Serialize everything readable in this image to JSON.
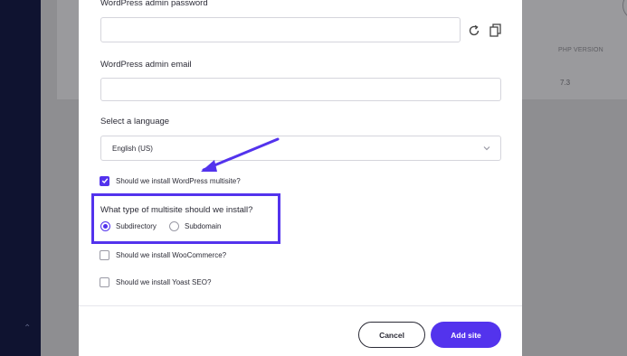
{
  "background": {
    "php_version_header": "PHP VERSION",
    "php_version_value": "7.3"
  },
  "modal": {
    "password": {
      "label": "WordPress admin password",
      "value": ""
    },
    "email": {
      "label": "WordPress admin email",
      "value": ""
    },
    "language": {
      "label": "Select a language",
      "selected": "English (US)"
    },
    "multisite": {
      "label": "Should we install WordPress multisite?",
      "checked": true
    },
    "multisite_type": {
      "question": "What type of multisite should we install?",
      "options": [
        {
          "label": "Subdirectory",
          "selected": true
        },
        {
          "label": "Subdomain",
          "selected": false
        }
      ]
    },
    "woocommerce": {
      "label": "Should we install WooCommerce?",
      "checked": false
    },
    "yoast": {
      "label": "Should we install Yoast SEO?",
      "checked": false
    },
    "buttons": {
      "cancel": "Cancel",
      "add": "Add site"
    }
  },
  "colors": {
    "accent": "#5333ed",
    "sidebar": "#0f1330",
    "overlay": "#8e8e91"
  },
  "icons": [
    "refresh-icon",
    "copy-icon",
    "chevron-down-icon",
    "lock-icon",
    "chevron-up-icon",
    "annotation-arrow"
  ]
}
